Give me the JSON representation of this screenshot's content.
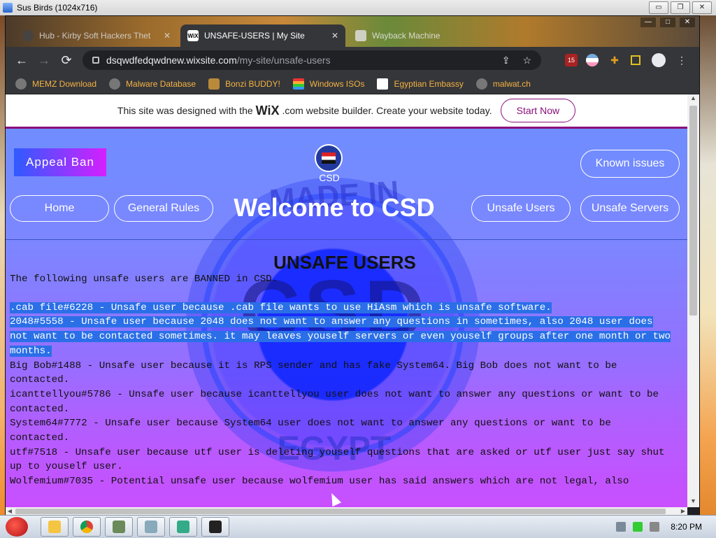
{
  "window": {
    "title": "Sus Birds (1024x716)"
  },
  "outer_controls": {
    "minimize": "▭",
    "restore": "❐",
    "close": "✕"
  },
  "tabs": [
    {
      "label": "Hub - Kirby Soft Hackers Thet",
      "fav": "",
      "close": "✕"
    },
    {
      "label": "UNSAFE-USERS | My Site",
      "fav": "WiX",
      "close": "✕"
    },
    {
      "label": "Wayback Machine",
      "fav": "",
      "close": ""
    }
  ],
  "chrome_controls": {
    "minimize": "—",
    "maximize": "□",
    "close": "✕"
  },
  "toolbar": {
    "back": "←",
    "forward": "→",
    "reload": "⟳",
    "share": "⇪",
    "star": "☆",
    "badge": "15",
    "menu": "⋮"
  },
  "address": {
    "host": "dsqwdfedqwdnew.wixsite.com",
    "path": "/my-site/unsafe-users"
  },
  "bookmarks": [
    {
      "label": "MEMZ Download"
    },
    {
      "label": "Malware Database"
    },
    {
      "label": "Bonzi BUDDY!"
    },
    {
      "label": "Windows ISOs"
    },
    {
      "label": "Egyptian Embassy"
    },
    {
      "label": "malwat.ch"
    }
  ],
  "wix_banner": {
    "text_before": "This site was designed with the",
    "logo": "WiX",
    "text_after": ".com website builder. Create your website today.",
    "cta": "Start Now"
  },
  "site": {
    "appeal": "Appeal Ban",
    "logo_caption": "CSD",
    "known_issues": "Known issues",
    "nav": {
      "home": "Home",
      "rules": "General Rules",
      "unsafe_users": "Unsafe Users",
      "unsafe_servers": "Unsafe Servers"
    },
    "welcome": "Welcome to CSD",
    "emblem": {
      "top": "MADE IN",
      "center": "CSD",
      "bottom": "EGYPT"
    },
    "section_title": "UNSAFE USERS",
    "intro": "The following unsafe users are BANNED in CSD.",
    "entries": [
      ".cab file#6228 - Unsafe user because .cab file wants to use HiAsm which is unsafe software.",
      "2048#5558 - Unsafe user because 2048 does not want to answer any questions in sometimes, also 2048 user does not want to be contacted sometimes. it may leaves youself servers or even youself groups after one month or two months.",
      "Big Bob#1488 - Unsafe user because it is RPS sender and has fake System64. Big Bob does not want to be contacted.",
      "icanttellyou#5786 - Unsafe user because icanttellyou user does not want to answer any questions or want to be contacted.",
      "System64#7772 - Unsafe user because System64 user does not want to answer any questions or want to be contacted.",
      "utf#7518 - Unsafe user because utf user is deleting youself questions that are asked or utf user just say shut up to youself user.",
      "Wolfemium#7035 - Potential unsafe user because wolfemium user has said answers which are not legal, also"
    ]
  },
  "scroll": {
    "up": "▲",
    "down": "▼",
    "left": "◀",
    "right": "▶"
  },
  "taskbar": {
    "clock": "8:20 PM"
  }
}
